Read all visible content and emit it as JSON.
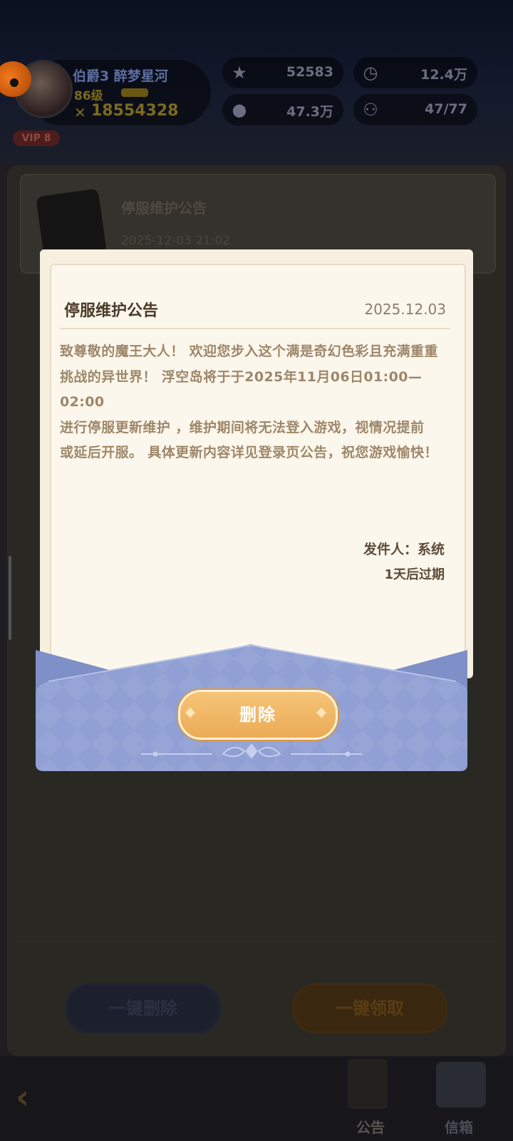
{
  "player": {
    "name": "伯爵3 醉梦星河",
    "level": "86级",
    "power": "18554328",
    "vip": "VIP 8"
  },
  "resources": [
    {
      "icon": "star-icon",
      "value": "52583"
    },
    {
      "icon": "clock-icon",
      "value": "12.4万"
    },
    {
      "icon": "coin-icon",
      "value": "47.3万"
    },
    {
      "icon": "friends-icon",
      "value": "47/77"
    }
  ],
  "mail_list_item": {
    "title": "停服维护公告",
    "date": "2025-12-03 21:02"
  },
  "modal": {
    "title": "停服维护公告",
    "date": "2025.12.03",
    "body_lines": [
      "致尊敬的魔王大人！ 欢迎您步入这个满是奇幻色彩且充满重重",
      "挑战的异世界！ 浮空岛将于于2025年11月06日01:00—02:00",
      "进行停服更新维护 ，维护期间将无法登入游戏，视情况提前",
      "或延后开服。 具体更新内容详见登录页公告，祝您游戏愉快！"
    ],
    "sender": "发件人：系统",
    "expiry": "1天后过期",
    "delete_label": "删除"
  },
  "actions": {
    "delete_all": "一键删除",
    "claim_all": "一键领取"
  },
  "nav": {
    "notice": "公告",
    "mailbox": "信箱"
  },
  "colors": {
    "accent_button": "#ebab56",
    "envelope_blue": "#8b9bd0",
    "letter_paper": "#fcf7ec"
  }
}
